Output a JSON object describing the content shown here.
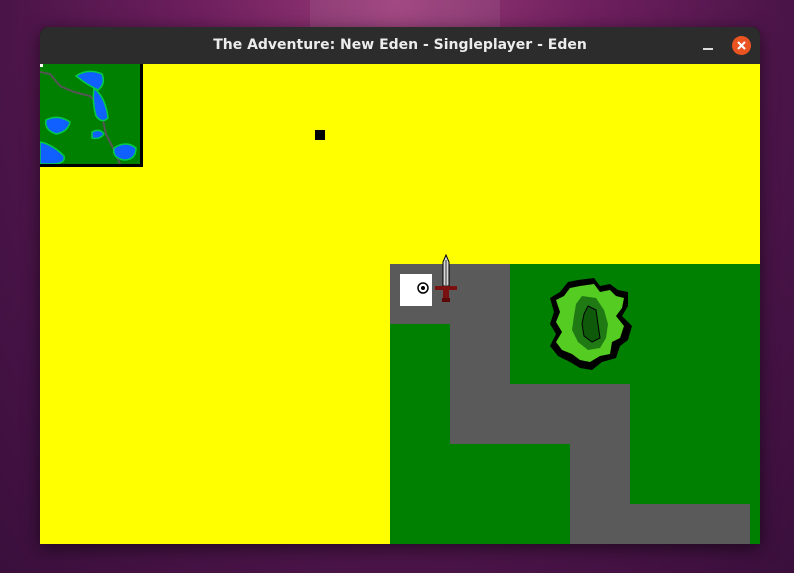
{
  "window": {
    "title": "The Adventure: New Eden - Singleplayer - Eden",
    "minimize_icon": "minimize-icon",
    "close_icon": "close-icon"
  },
  "colors": {
    "sand": "#ffff00",
    "grass": "#008000",
    "road": "#5a5a5a",
    "water": "#1060ff",
    "bush": "#55cc22",
    "close_button": "#e95420"
  },
  "game": {
    "minimap_icon": "minimap",
    "player_icon": "player-marker-icon",
    "sword_icon": "sword-icon",
    "tree_icon": "tree-icon",
    "item_icon": "item-dot-icon"
  }
}
